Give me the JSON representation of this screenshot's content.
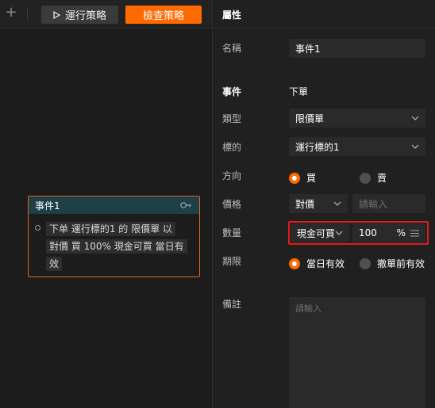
{
  "toolbar": {
    "add_icon": "plus-icon",
    "run_label": "運行策略",
    "run_icon": "play-icon",
    "check_label": "檢查策略"
  },
  "node": {
    "title": "事件1",
    "icon": "key-icon",
    "description_lines": [
      "下单 運行標的1 的 限價單 以",
      "對價 買 100% 現金可買 當日有",
      "效"
    ]
  },
  "panel": {
    "title": "屬性",
    "name_label": "名稱",
    "name_value": "事件1",
    "event_label": "事件",
    "event_value": "下單",
    "type_label": "類型",
    "type_value": "限價單",
    "target_label": "標的",
    "target_value": "運行標的1",
    "direction_label": "方向",
    "direction_options": [
      "買",
      "賣"
    ],
    "direction_selected": "買",
    "price_label": "價格",
    "price_mode": "對價",
    "price_placeholder": "請輸入",
    "qty_label": "數量",
    "qty_mode": "現金可買",
    "qty_value": "100",
    "qty_unit": "%",
    "expiry_label": "期限",
    "expiry_options": [
      "當日有效",
      "撤單前有效"
    ],
    "expiry_selected": "當日有效",
    "note_label": "備註",
    "note_placeholder": "請輸入"
  },
  "colors": {
    "accent": "#ff6a00",
    "highlight_frame": "#e21a1a",
    "node_header": "#1e3f48"
  }
}
